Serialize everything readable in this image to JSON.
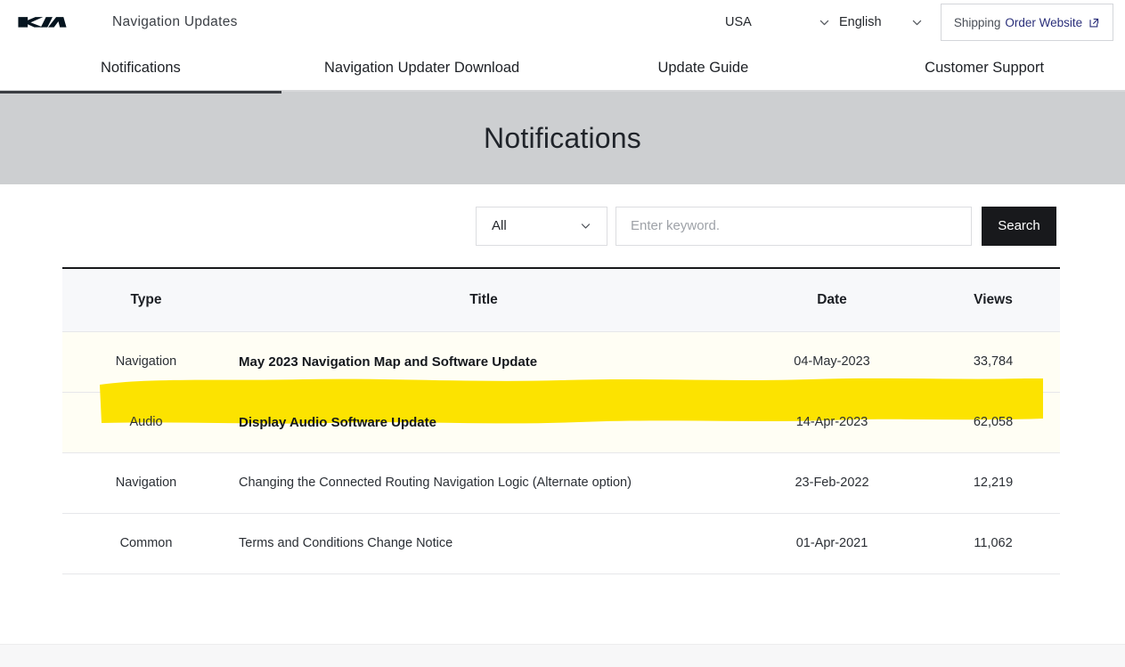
{
  "header": {
    "logo_alt": "KIA",
    "brand_title": "Navigation Updates",
    "country": "USA",
    "language": "English",
    "shipping_button": {
      "word1": "Shipping",
      "word2": "Order Website"
    }
  },
  "nav": {
    "tabs": [
      {
        "label": "Notifications",
        "active": true
      },
      {
        "label": "Navigation Updater Download",
        "active": false
      },
      {
        "label": "Update Guide",
        "active": false
      },
      {
        "label": "Customer Support",
        "active": false
      }
    ]
  },
  "banner": {
    "title": "Notifications"
  },
  "search": {
    "category_selected": "All",
    "keyword_value": "",
    "keyword_placeholder": "Enter keyword.",
    "search_label": "Search"
  },
  "table": {
    "columns": [
      "Type",
      "Title",
      "Date",
      "Views"
    ],
    "rows": [
      {
        "type": "Navigation",
        "title": "May 2023 Navigation Map and Software Update",
        "date": "04-May-2023",
        "views": "33,784",
        "bold": true,
        "tinted": true,
        "highlighted": false
      },
      {
        "type": "Audio",
        "title": "Display Audio Software Update",
        "date": "14-Apr-2023",
        "views": "62,058",
        "bold": true,
        "tinted": true,
        "highlighted": true
      },
      {
        "type": "Navigation",
        "title": "Changing the Connected Routing Navigation Logic (Alternate option)",
        "date": "23-Feb-2022",
        "views": "12,219",
        "bold": false,
        "tinted": false,
        "highlighted": false
      },
      {
        "type": "Common",
        "title": "Terms and Conditions Change Notice",
        "date": "01-Apr-2021",
        "views": "11,062",
        "bold": false,
        "tinted": false,
        "highlighted": false
      }
    ]
  },
  "colors": {
    "highlight_yellow": "#FCE300",
    "banner_gray": "#CDCFD1",
    "search_button_black": "#18191C",
    "active_tab_underline": "#3A3D42",
    "row_tint": "#FFFEF4",
    "link_navy": "#2A2F7A"
  }
}
